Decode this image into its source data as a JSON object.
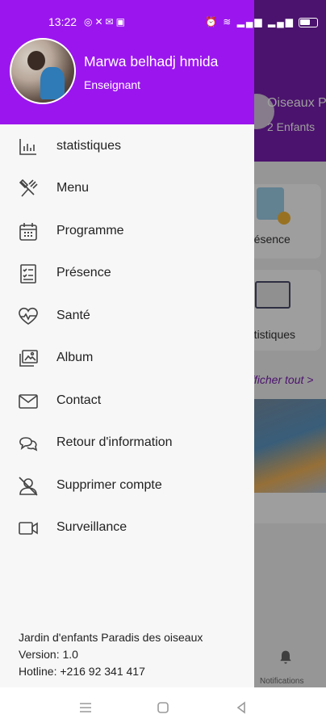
{
  "status_bar": {
    "time": "13:22",
    "left_icons": [
      "whatsapp-icon",
      "x-icon",
      "mail-icon",
      "app-icon"
    ],
    "right_icons": [
      "alarm-icon",
      "wifi-icon",
      "signal-icon",
      "signal-icon",
      "battery-icon"
    ]
  },
  "background_screen": {
    "class_name": "Oiseaux P",
    "class_count": "2 Enfants",
    "card_1_label": "résence",
    "card_2_label": "tatistiques",
    "see_all_link": "fficher tout >",
    "notifications_label": "Notifications"
  },
  "drawer": {
    "profile": {
      "name": "Marwa belhadj hmida",
      "role": "Enseignant"
    },
    "items": [
      {
        "label": "statistiques",
        "icon": "bar-chart-icon"
      },
      {
        "label": "Menu",
        "icon": "utensils-icon"
      },
      {
        "label": "Programme",
        "icon": "calendar-icon"
      },
      {
        "label": "Présence",
        "icon": "checklist-icon"
      },
      {
        "label": "Santé",
        "icon": "heartbeat-icon"
      },
      {
        "label": "Album",
        "icon": "photo-album-icon"
      },
      {
        "label": "Contact",
        "icon": "envelope-icon"
      },
      {
        "label": "Retour d'information",
        "icon": "chat-bubbles-icon"
      },
      {
        "label": "Supprimer compte",
        "icon": "user-slash-icon"
      },
      {
        "label": "Surveillance",
        "icon": "video-camera-icon"
      }
    ],
    "footer": {
      "school": "Jardin d'enfants Paradis des oiseaux",
      "version": "Version: 1.0",
      "hotline": "Hotline: +216 92 341 417"
    }
  },
  "nav_bar": {
    "buttons": [
      "menu-icon",
      "home-icon",
      "back-icon"
    ]
  },
  "colors": {
    "drawer_header": "#9b16ee",
    "app_header": "#7a1fb0",
    "drawer_background": "#f7f7f7"
  }
}
